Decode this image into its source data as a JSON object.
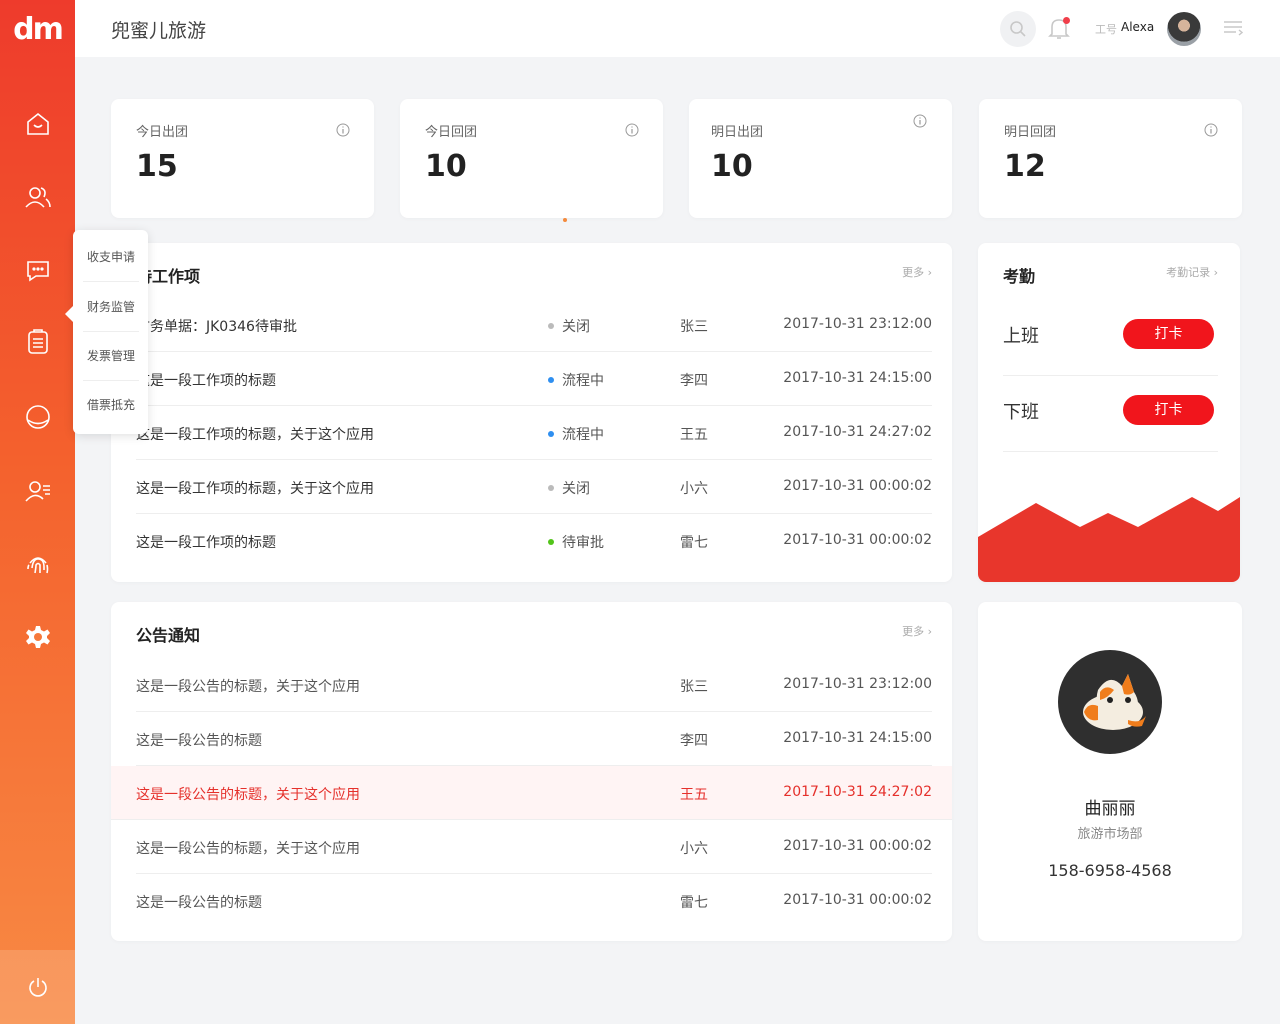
{
  "brand": {
    "logo": "dm",
    "accent": "#ef3a2b",
    "accent_light": "#f88a44"
  },
  "header": {
    "title": "兜蜜儿旅游",
    "user_label": "工号",
    "user_name": "Alexa"
  },
  "sidebar": {
    "items": [
      {
        "icon": "home-icon"
      },
      {
        "icon": "users-icon"
      },
      {
        "icon": "chat-icon"
      },
      {
        "icon": "document-icon"
      },
      {
        "icon": "globe-icon"
      },
      {
        "icon": "user-list-icon"
      },
      {
        "icon": "fingerprint-icon"
      },
      {
        "icon": "settings-icon"
      }
    ],
    "power_icon": "power-icon"
  },
  "popup_menu": {
    "items": [
      "收支申请",
      "财务监管",
      "发票管理",
      "借票抵充"
    ]
  },
  "stats": [
    {
      "label": "今日出团",
      "value": "15"
    },
    {
      "label": "今日回团",
      "value": "10"
    },
    {
      "label": "明日出团",
      "value": "10"
    },
    {
      "label": "明日回团",
      "value": "12"
    }
  ],
  "work": {
    "title": "待工作项",
    "more": "更多",
    "rows": [
      {
        "title": "财务单据：JK0346待审批",
        "status": "关闭",
        "status_color": "#bbbbbb",
        "person": "张三",
        "time": "2017-10-31  23:12:00"
      },
      {
        "title": "这是一段工作项的标题",
        "status": "流程中",
        "status_color": "#2f8ff0",
        "person": "李四",
        "time": "2017-10-31  24:15:00"
      },
      {
        "title": "这是一段工作项的标题，关于这个应用",
        "status": "流程中",
        "status_color": "#2f8ff0",
        "person": "王五",
        "time": "2017-10-31  24:27:02"
      },
      {
        "title": "这是一段工作项的标题，关于这个应用",
        "status": "关闭",
        "status_color": "#bbbbbb",
        "person": "小六",
        "time": "2017-10-31  00:00:02"
      },
      {
        "title": "这是一段工作项的标题",
        "status": "待审批",
        "status_color": "#52c41a",
        "person": "雷七",
        "time": "2017-10-31  00:00:02"
      }
    ]
  },
  "notice": {
    "title": "公告通知",
    "more": "更多",
    "rows": [
      {
        "title": "这是一段公告的标题，关于这个应用",
        "person": "张三",
        "time": "2017-10-31  23:12:00"
      },
      {
        "title": "这是一段公告的标题",
        "person": "李四",
        "time": "2017-10-31  24:15:00"
      },
      {
        "title": "这是一段公告的标题，关于这个应用",
        "person": "王五",
        "time": "2017-10-31  24:27:02"
      },
      {
        "title": "这是一段公告的标题，关于这个应用",
        "person": "小六",
        "time": "2017-10-31  00:00:02"
      },
      {
        "title": "这是一段公告的标题",
        "person": "雷七",
        "time": "2017-10-31  00:00:02"
      }
    ]
  },
  "attendance": {
    "title": "考勤",
    "record_link": "考勤记录",
    "on_label": "上班",
    "off_label": "下班",
    "punch_label": "打卡"
  },
  "profile": {
    "name": "曲丽丽",
    "department": "旅游市场部",
    "phone": "158-6958-4568"
  }
}
